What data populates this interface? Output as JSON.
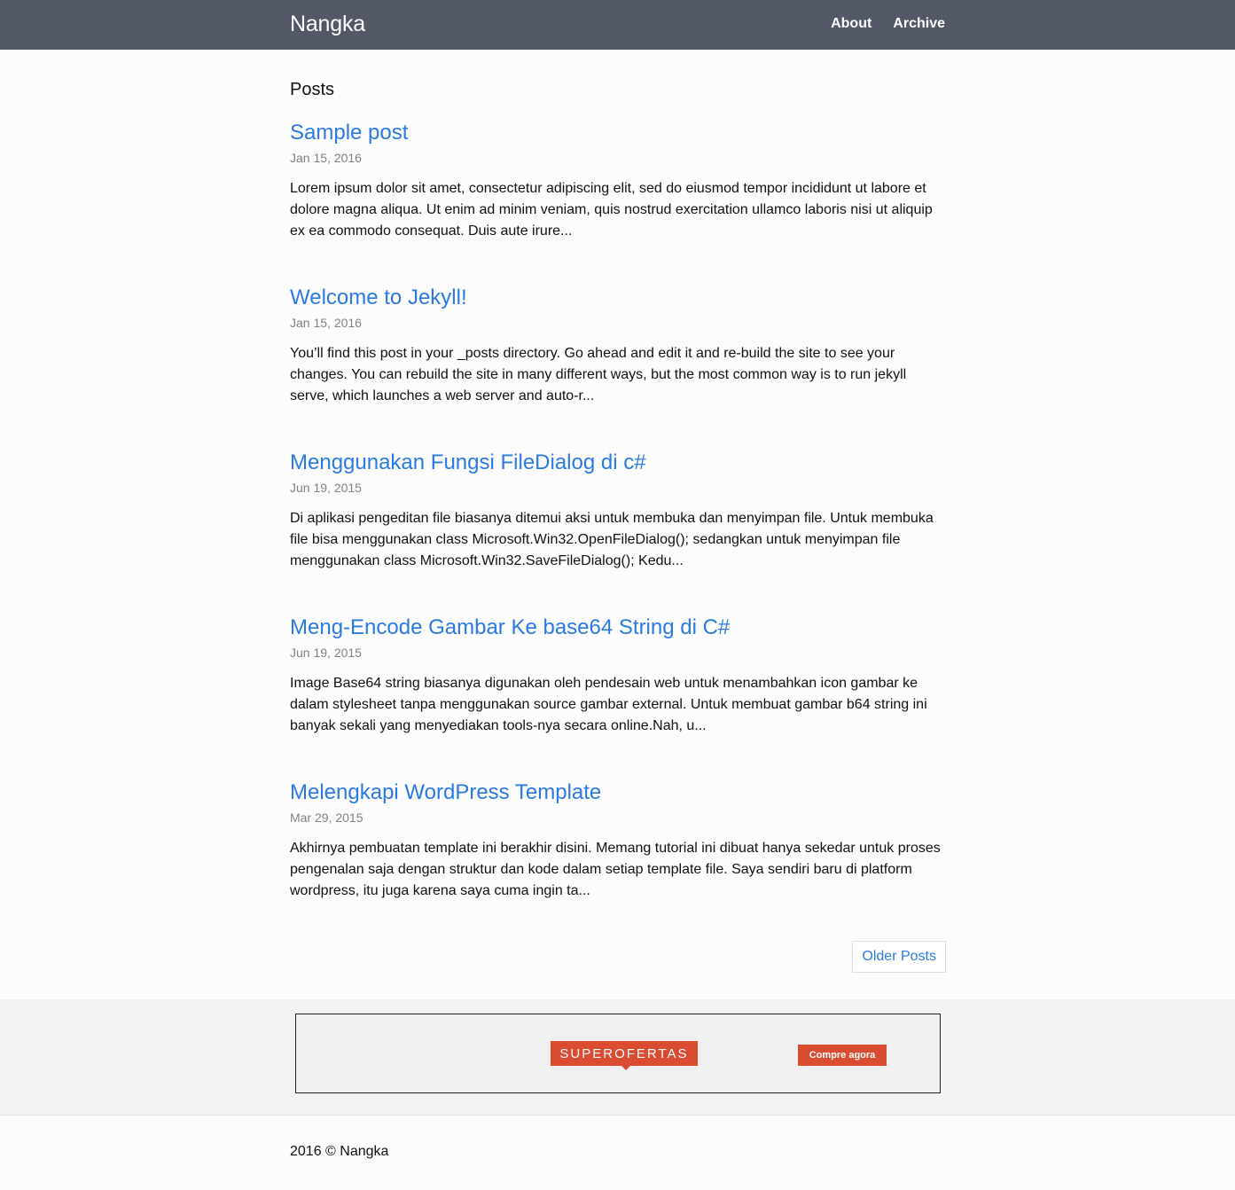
{
  "header": {
    "brand": "Nangka",
    "nav": [
      {
        "label": "About"
      },
      {
        "label": "Archive"
      }
    ]
  },
  "main": {
    "section_title": "Posts",
    "posts": [
      {
        "title": "Sample post",
        "date": "Jan 15, 2016",
        "excerpt": "Lorem ipsum dolor sit amet, consectetur adipiscing elit, sed do eiusmod tempor incididunt ut labore et dolore magna aliqua. Ut enim ad minim veniam, quis nostrud exercitation ullamco laboris nisi ut aliquip ex ea commodo consequat. Duis aute irure..."
      },
      {
        "title": "Welcome to Jekyll!",
        "date": "Jan 15, 2016",
        "excerpt": "You’ll find this post in your _posts directory. Go ahead and edit it and re-build the site to see your changes. You can rebuild the site in many different ways, but the most common way is to run jekyll serve, which launches a web server and auto-r..."
      },
      {
        "title": "Menggunakan Fungsi FileDialog di c#",
        "date": "Jun 19, 2015",
        "excerpt": "Di aplikasi pengeditan file biasanya ditemui aksi untuk membuka dan menyimpan file. Untuk membuka file bisa menggunakan class Microsoft.Win32.OpenFileDialog(); sedangkan untuk menyimpan file menggunakan class Microsoft.Win32.SaveFileDialog(); Kedu..."
      },
      {
        "title": "Meng-Encode Gambar Ke base64 String di C#",
        "date": "Jun 19, 2015",
        "excerpt": "Image Base64 string biasanya digunakan oleh pendesain web untuk menambahkan icon gambar ke dalam stylesheet tanpa menggunakan source gambar external. Untuk membuat gambar b64 string ini banyak sekali yang menyediakan tools-nya secara online.Nah, u..."
      },
      {
        "title": "Melengkapi WordPress Template",
        "date": "Mar 29, 2015",
        "excerpt": "Akhirnya pembuatan template ini berakhir disini. Memang tutorial ini dibuat hanya sekedar untuk proses pengenalan saja dengan struktur dan kode dalam setiap template file. Saya sendiri baru di platform wordpress, itu juga karena saya cuma ingin ta..."
      }
    ],
    "older_posts_label": "Older Posts"
  },
  "ad": {
    "logo_text": "SUPEROFERTAS",
    "button_label": "Compre agora",
    "accent_color": "#d94c32"
  },
  "footer": {
    "text": "2016 © Nangka"
  },
  "colors": {
    "header_bg": "#525866",
    "link": "#2a7ae2",
    "meta": "#828282"
  }
}
